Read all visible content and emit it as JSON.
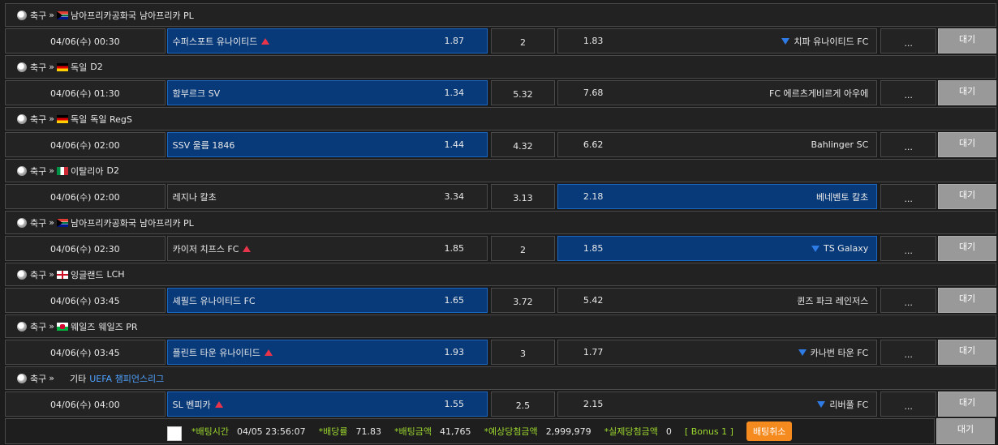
{
  "sport": "축구",
  "separator": "»",
  "more_label": "...",
  "wait_label": "대기",
  "games": [
    {
      "country": "남아프리카공화국",
      "league": "남아프리카 PL",
      "flag": "za",
      "time": "04/06(수) 00:30",
      "home": "수퍼스포트 유나이티드",
      "home_odds": "1.87",
      "draw": "2",
      "away_odds": "1.83",
      "away": "치파 유나이티드 FC",
      "home_sel": true,
      "away_sel": false,
      "home_up": true,
      "away_down": true
    },
    {
      "country": "독일",
      "league": "D2",
      "flag": "de",
      "time": "04/06(수) 01:30",
      "home": "함부르크 SV",
      "home_odds": "1.34",
      "draw": "5.32",
      "away_odds": "7.68",
      "away": "FC 에르츠게비르게 아우에",
      "home_sel": true,
      "away_sel": false,
      "home_up": false,
      "away_down": false
    },
    {
      "country": "독일",
      "league": "독일 RegS",
      "flag": "de",
      "time": "04/06(수) 02:00",
      "home": "SSV 울름 1846",
      "home_odds": "1.44",
      "draw": "4.32",
      "away_odds": "6.62",
      "away": "Bahlinger SC",
      "home_sel": true,
      "away_sel": false,
      "home_up": false,
      "away_down": false
    },
    {
      "country": "이탈리아",
      "league": "D2",
      "flag": "it",
      "time": "04/06(수) 02:00",
      "home": "레지나 칼초",
      "home_odds": "3.34",
      "draw": "3.13",
      "away_odds": "2.18",
      "away": "베네벤토 칼초",
      "home_sel": false,
      "away_sel": true,
      "home_up": false,
      "away_down": false
    },
    {
      "country": "남아프리카공화국",
      "league": "남아프리카 PL",
      "flag": "za",
      "time": "04/06(수) 02:30",
      "home": "카이저 치프스 FC",
      "home_odds": "1.85",
      "draw": "2",
      "away_odds": "1.85",
      "away": "TS Galaxy",
      "home_sel": false,
      "away_sel": true,
      "home_up": true,
      "away_down": true
    },
    {
      "country": "잉글랜드",
      "league": "LCH",
      "flag": "en",
      "time": "04/06(수) 03:45",
      "home": "셰필드 유나이티드 FC",
      "home_odds": "1.65",
      "draw": "3.72",
      "away_odds": "5.42",
      "away": "퀸즈 파크 레인저스",
      "home_sel": true,
      "away_sel": false,
      "home_up": false,
      "away_down": false
    },
    {
      "country": "웨일즈",
      "league": "웨일즈 PR",
      "flag": "wl",
      "time": "04/06(수) 03:45",
      "home": "플린트 타운 유나이티드",
      "home_odds": "1.93",
      "draw": "3",
      "away_odds": "1.77",
      "away": "카나번 타운 FC",
      "home_sel": true,
      "away_sel": false,
      "home_up": true,
      "away_down": true
    },
    {
      "country": "",
      "league": "UEFA 챔피언스리그",
      "other": "기타",
      "flag": "",
      "time": "04/06(수) 04:00",
      "home": "SL 벤피카",
      "home_odds": "1.55",
      "draw": "2.5",
      "away_odds": "2.15",
      "away": "리버풀 FC",
      "home_sel": true,
      "away_sel": false,
      "home_up": true,
      "away_down": true
    }
  ],
  "footer": {
    "bet_time_label": "*배팅시간",
    "bet_time": "04/05 23:56:07",
    "odds_label": "*배당률",
    "odds": "71.83",
    "amount_label": "*배팅금액",
    "amount": "41,765",
    "expected_label": "*예상당첨금액",
    "expected": "2,999,979",
    "actual_label": "*실제당첨금액",
    "actual": "0",
    "bonus": "[ Bonus 1 ]",
    "cancel_label": "배팅취소",
    "wait_label": "대기"
  },
  "colors": {
    "selected": "#083a7a",
    "up": "#e8344a",
    "down": "#2f7be6",
    "label_green": "#9bd62e",
    "cancel": "#f58a1f"
  }
}
